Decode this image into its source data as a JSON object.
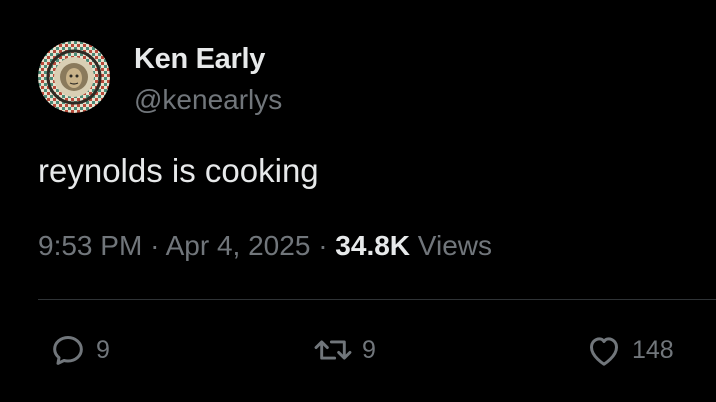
{
  "author": {
    "display_name": "Ken Early",
    "handle": "@kenearlys",
    "avatar_icon": "mosaic-medusa-avatar"
  },
  "tweet": {
    "text": "reynolds is cooking",
    "time": "9:53 PM",
    "separator": "·",
    "date": "Apr 4, 2025",
    "views_count": "34.8K",
    "views_label": "Views"
  },
  "actions": {
    "reply": {
      "icon": "reply-icon",
      "count": "9"
    },
    "retweet": {
      "icon": "retweet-icon",
      "count": "9"
    },
    "like": {
      "icon": "heart-icon",
      "count": "148"
    }
  },
  "colors": {
    "background": "#000000",
    "primary_text": "#e7e9ea",
    "secondary_text": "#71767b",
    "divider": "#2f3336"
  }
}
